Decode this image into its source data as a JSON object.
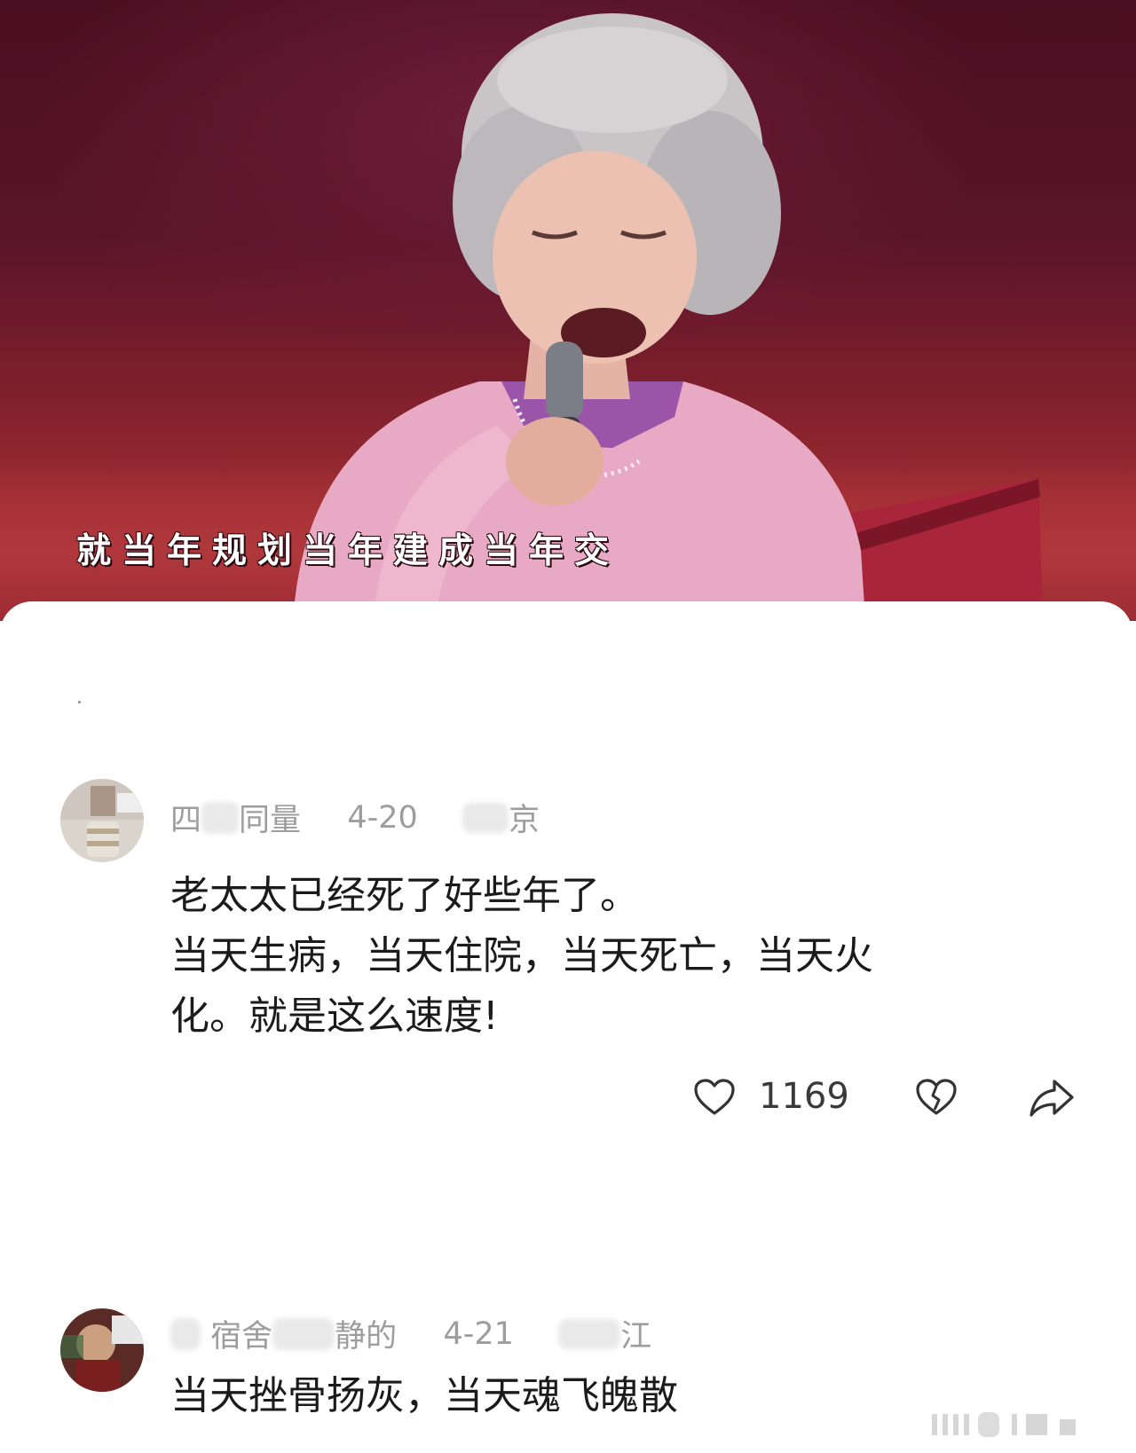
{
  "video": {
    "subtitle": "就当年规划当年建成当年交"
  },
  "comments": [
    {
      "username_visible": "四",
      "username_tail": "同量",
      "date": "4-20",
      "location_tail": "京",
      "text_lines": [
        "老太太已经死了好些年了。",
        "当天生病，当天住院，当天死亡，当天火",
        "化。就是这么速度!"
      ],
      "likes": "1169"
    },
    {
      "username_visible": "宿舍",
      "username_tail": "静的",
      "date": "4-21",
      "location_tail": "江",
      "text_lines": [
        "当天挫骨扬灰，当天魂飞魄散"
      ]
    }
  ],
  "icons": {
    "like": "heart-outline-icon",
    "dislike": "broken-heart-icon",
    "share": "share-arrow-icon"
  },
  "colors": {
    "meta_text": "#9d9d9d",
    "comment_text": "#1b1b1b",
    "icon_stroke": "#333333"
  }
}
